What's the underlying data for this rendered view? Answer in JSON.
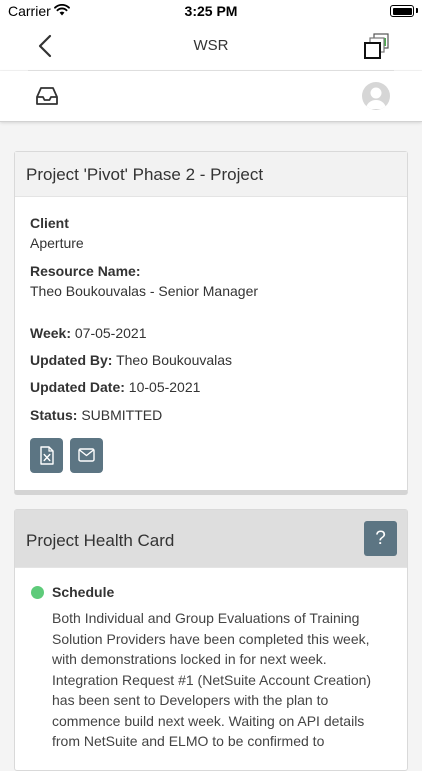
{
  "status_bar": {
    "carrier": "Carrier",
    "time": "3:25 PM",
    "battery_level": 1.0
  },
  "nav": {
    "title": "WSR",
    "back_icon": "chevron-left-icon",
    "windows_icon": "stacked-windows-icon"
  },
  "toolbar": {
    "inbox_icon": "inbox-tray-icon",
    "avatar_icon": "user-avatar-icon"
  },
  "report_card": {
    "title": "Project 'Pivot' Phase 2 - Project",
    "client_label": "Client",
    "client_value": "Aperture",
    "resource_label": "Resource Name:",
    "resource_value": "Theo Boukouvalas - Senior Manager",
    "week_label": "Week:",
    "week_value": "07-05-2021",
    "updated_by_label": "Updated By:",
    "updated_by_value": "Theo Boukouvalas",
    "updated_date_label": "Updated Date:",
    "updated_date_value": "10-05-2021",
    "status_label": "Status:",
    "status_value": "SUBMITTED",
    "excel_icon": "excel-file-icon",
    "mail_icon": "envelope-icon"
  },
  "health_card": {
    "title": "Project Health Card",
    "help_label": "?",
    "schedule_label": "Schedule",
    "schedule_status_color": "#5ecb7a",
    "schedule_text": "Both Individual and Group Evaluations of Training Solution Providers have been completed this week, with demonstrations locked in for next week. Integration Request #1 (NetSuite Account Creation) has been sent to Developers with the plan to commence build next week. Waiting on API details from NetSuite and ELMO to be confirmed to"
  },
  "colors": {
    "accent_button": "#5c7583",
    "card_header": "#f2f2f2",
    "status_green": "#5ecb7a"
  }
}
